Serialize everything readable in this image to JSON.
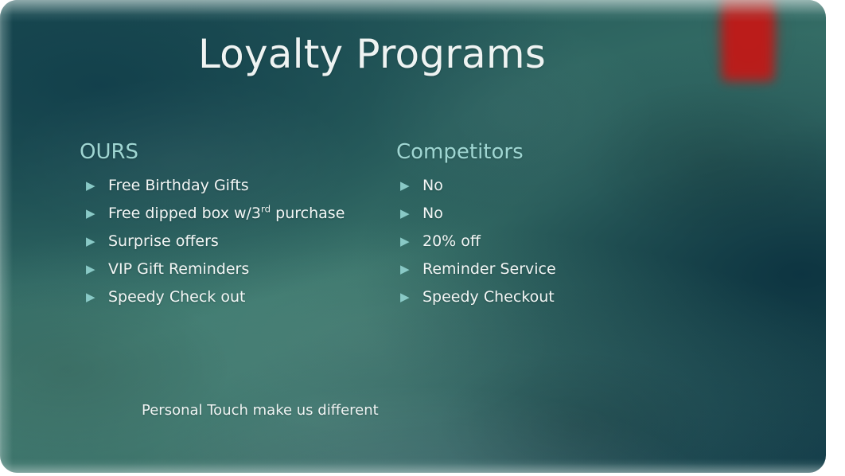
{
  "slide": {
    "title": "Loyalty Programs",
    "footnote": "Personal Touch make us different",
    "bullet_glyph": "▶",
    "colors": {
      "heading": "#9fd6d2",
      "body_text": "#f2f6f5",
      "bullet_marker": "#89c9c6",
      "accent_red": "#c01a18",
      "background_teal_light": "#3b756b",
      "background_teal_dark": "#16404e"
    },
    "columns": [
      {
        "heading": "OURS",
        "bullets": [
          {
            "text": "Free Birthday Gifts"
          },
          {
            "text_before": "Free dipped box w/3",
            "superscript": "rd",
            "text_after": " purchase"
          },
          {
            "text": "Surprise offers"
          },
          {
            "text": "VIP Gift Reminders"
          },
          {
            "text": "Speedy Check out"
          }
        ]
      },
      {
        "heading": "Competitors",
        "bullets": [
          {
            "text": "No"
          },
          {
            "text": "No"
          },
          {
            "text": "20% off"
          },
          {
            "text": "Reminder Service"
          },
          {
            "text": "Speedy Checkout"
          }
        ]
      }
    ]
  }
}
